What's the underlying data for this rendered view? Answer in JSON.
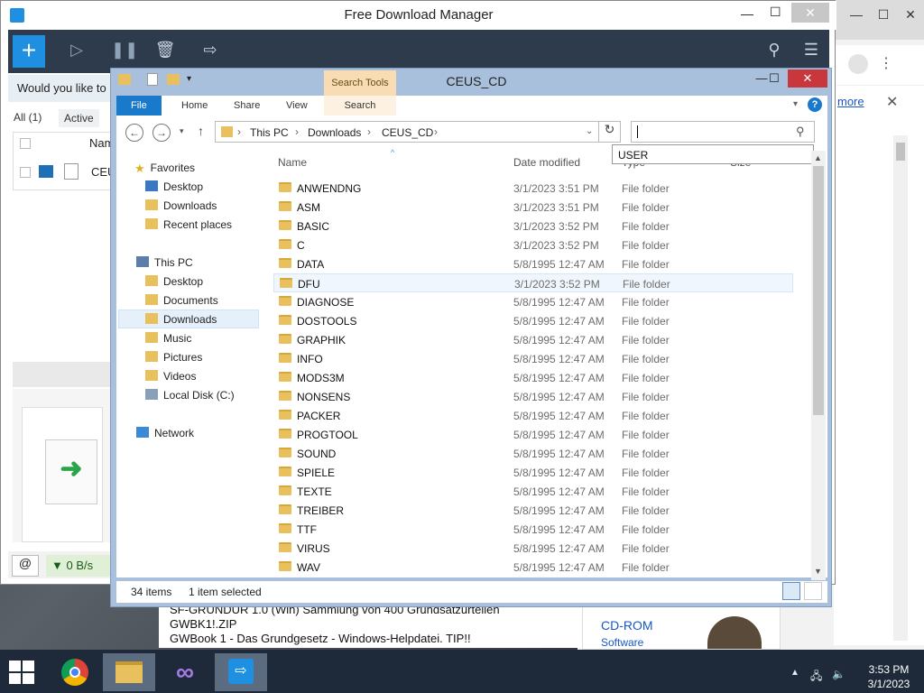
{
  "fdm": {
    "title": "Free Download Manager",
    "notice": "Would you like to",
    "filters": [
      "All (1)",
      "Active"
    ],
    "column_name": "Nam",
    "item_name": "CEU",
    "speed": "▼ 0 B/s"
  },
  "chrome": {
    "more_link": "more"
  },
  "web": {
    "lines": [
      "SF-GRUNDUR 1.0 (Win) Sammlung von 400 Grundsatzurteilen",
      "GWBK1!.ZIP",
      "GWBook 1 - Das Grundgesetz - Windows-Helpdatei. TIP!!"
    ],
    "side_title": "CD-ROM",
    "side_sub": "Software"
  },
  "explorer": {
    "title": "CEUS_CD",
    "search_tools_label": "Search Tools",
    "tabs": [
      "File",
      "Home",
      "Share",
      "View",
      "Search"
    ],
    "breadcrumb": [
      "This PC",
      "Downloads",
      "CEUS_CD"
    ],
    "search_suggestion": "USER",
    "columns": {
      "name": "Name",
      "date": "Date modified",
      "type": "Type",
      "size": "Size"
    },
    "nav": {
      "favorites": "Favorites",
      "fav_items": [
        "Desktop",
        "Downloads",
        "Recent places"
      ],
      "this_pc": "This PC",
      "pc_items": [
        "Desktop",
        "Documents",
        "Downloads",
        "Music",
        "Pictures",
        "Videos",
        "Local Disk (C:)"
      ],
      "network": "Network"
    },
    "files": [
      {
        "name": "ANWENDNG",
        "date": "3/1/2023 3:51 PM",
        "type": "File folder"
      },
      {
        "name": "ASM",
        "date": "3/1/2023 3:51 PM",
        "type": "File folder"
      },
      {
        "name": "BASIC",
        "date": "3/1/2023 3:52 PM",
        "type": "File folder"
      },
      {
        "name": "C",
        "date": "3/1/2023 3:52 PM",
        "type": "File folder"
      },
      {
        "name": "DATA",
        "date": "5/8/1995 12:47 AM",
        "type": "File folder"
      },
      {
        "name": "DFU",
        "date": "3/1/2023 3:52 PM",
        "type": "File folder"
      },
      {
        "name": "DIAGNOSE",
        "date": "5/8/1995 12:47 AM",
        "type": "File folder"
      },
      {
        "name": "DOSTOOLS",
        "date": "5/8/1995 12:47 AM",
        "type": "File folder"
      },
      {
        "name": "GRAPHIK",
        "date": "5/8/1995 12:47 AM",
        "type": "File folder"
      },
      {
        "name": "INFO",
        "date": "5/8/1995 12:47 AM",
        "type": "File folder"
      },
      {
        "name": "MODS3M",
        "date": "5/8/1995 12:47 AM",
        "type": "File folder"
      },
      {
        "name": "NONSENS",
        "date": "5/8/1995 12:47 AM",
        "type": "File folder"
      },
      {
        "name": "PACKER",
        "date": "5/8/1995 12:47 AM",
        "type": "File folder"
      },
      {
        "name": "PROGTOOL",
        "date": "5/8/1995 12:47 AM",
        "type": "File folder"
      },
      {
        "name": "SOUND",
        "date": "5/8/1995 12:47 AM",
        "type": "File folder"
      },
      {
        "name": "SPIELE",
        "date": "5/8/1995 12:47 AM",
        "type": "File folder"
      },
      {
        "name": "TEXTE",
        "date": "5/8/1995 12:47 AM",
        "type": "File folder"
      },
      {
        "name": "TREIBER",
        "date": "5/8/1995 12:47 AM",
        "type": "File folder"
      },
      {
        "name": "TTF",
        "date": "5/8/1995 12:47 AM",
        "type": "File folder"
      },
      {
        "name": "VIRUS",
        "date": "5/8/1995 12:47 AM",
        "type": "File folder"
      },
      {
        "name": "WAV",
        "date": "5/8/1995 12:47 AM",
        "type": "File folder"
      }
    ],
    "selected_file": "DFU",
    "status_items": "34 items",
    "status_selected": "1 item selected"
  },
  "taskbar": {
    "time": "3:53 PM",
    "date": "3/1/2023"
  },
  "colors": {
    "fdm_toolbar": "#2d3b4d",
    "fdm_accent": "#1e8fe1",
    "explorer_frame": "#a9c0dc",
    "file_tab": "#1979ca",
    "close_button": "#c7373b",
    "folder": "#e8c15e",
    "taskbar": "#1e2a3a"
  }
}
